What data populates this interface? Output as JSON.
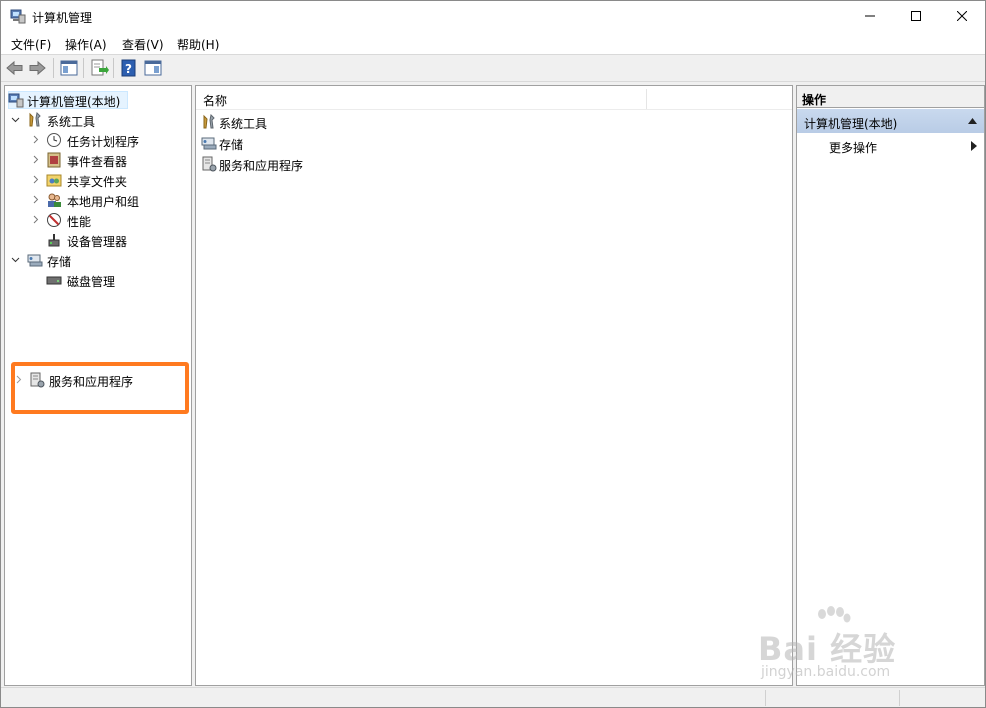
{
  "window": {
    "title": "计算机管理"
  },
  "menu": [
    "文件(F)",
    "操作(A)",
    "查看(V)",
    "帮助(H)"
  ],
  "tree": {
    "root": "计算机管理(本地)",
    "system_tools": "系统工具",
    "system_tools_children": [
      "任务计划程序",
      "事件查看器",
      "共享文件夹",
      "本地用户和组",
      "性能",
      "设备管理器"
    ],
    "storage": "存储",
    "storage_children": [
      "磁盘管理"
    ],
    "services": "服务和应用程序"
  },
  "list": {
    "column_name": "名称",
    "items": [
      "系统工具",
      "存储",
      "服务和应用程序"
    ]
  },
  "actions": {
    "header": "操作",
    "section": "计算机管理(本地)",
    "more": "更多操作"
  },
  "watermark": {
    "text": "Bai 经验",
    "sub": "jingyan.baidu.com"
  },
  "colors": {
    "highlight": "#ff7a1f",
    "selection": "#e5f3ff",
    "action_section": "#c9d9ee"
  }
}
